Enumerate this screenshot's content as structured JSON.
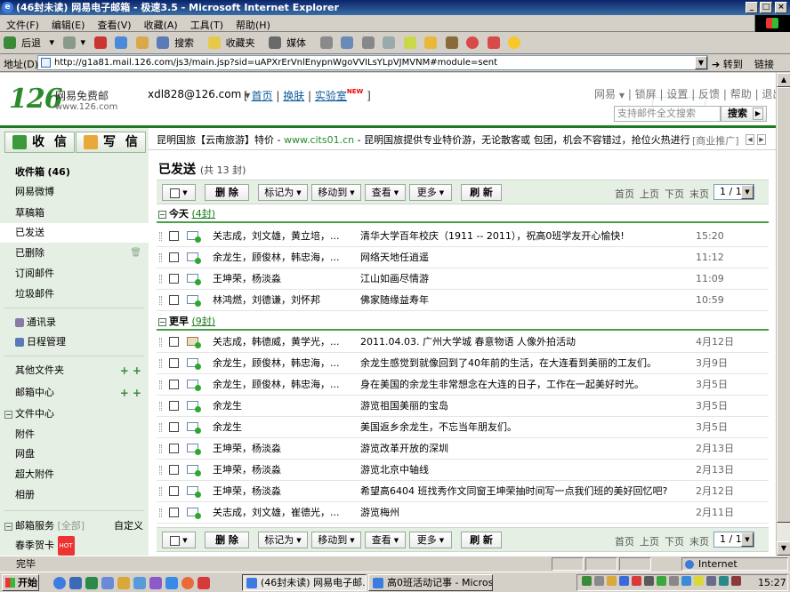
{
  "window": {
    "title": "(46封未读) 网易电子邮箱 - 极速3.5 - Microsoft Internet Explorer"
  },
  "menubar": [
    "文件(F)",
    "编辑(E)",
    "查看(V)",
    "收藏(A)",
    "工具(T)",
    "帮助(H)"
  ],
  "toolbar": {
    "back": "后退",
    "search": "搜索",
    "favorites": "收藏夹",
    "media": "媒体"
  },
  "address": {
    "label": "地址(D)",
    "url": "http://g1a81.mail.126.com/js3/main.jsp?sid=uAPXrErVnlEnypnWgoVVILsYLpVJMVNM#module=sent",
    "go": "转到",
    "links": "链接"
  },
  "header": {
    "logo": "126",
    "brand": "网易免费邮",
    "brand_url": "www.126.com",
    "account": "xdl828@126.com",
    "top_links": [
      "首页",
      "换肤",
      "实验室"
    ],
    "new_badge": "NEW",
    "right_links": [
      "网易",
      "锁屏",
      "设置",
      "反馈",
      "帮助",
      "退出"
    ],
    "search_placeholder": "支持邮件全文搜索",
    "search_button": "搜索"
  },
  "compose": {
    "receive": "收 信",
    "write": "写 信"
  },
  "nav": {
    "inbox": "收件箱",
    "inbox_count": "(46)",
    "weibo": "网易微博",
    "drafts": "草稿箱",
    "sent": "已发送",
    "deleted": "已删除",
    "subscription": "订阅邮件",
    "spam": "垃圾邮件",
    "contacts": "通讯录",
    "calendar": "日程管理",
    "other_folders": "其他文件夹",
    "mail_center": "邮箱中心",
    "file_center": "文件中心",
    "attachments": "附件",
    "netdisk": "网盘",
    "large_attach": "超大附件",
    "album": "相册",
    "services": "邮箱服务",
    "services_all": "[全部]",
    "customize": "自定义",
    "spring_card": "春季贺卡",
    "hot": "HOT"
  },
  "ad": {
    "text_pre": "昆明国旅【云南旅游】特价 - ",
    "url": "www.cits01.cn",
    "text_post": " - 昆明国旅提供专业特价游，无论散客或 包团，机会不容错过，抢位火热进行",
    "tag": "[商业推广]"
  },
  "folder": {
    "title": "已发送",
    "count": "(共 13 封)"
  },
  "actions": {
    "delete": "删 除",
    "mark": "标记为",
    "move": "移动到",
    "view": "查看",
    "more": "更多",
    "refresh": "刷 新",
    "first": "首页",
    "prev": "上页",
    "next": "下页",
    "last": "末页",
    "page": "1 / 1"
  },
  "groups": [
    {
      "label": "今天",
      "count": "(4封)",
      "rows": [
        {
          "from": "关志成，刘文雄，黄立培，...",
          "subject": "清华大学百年校庆（1911 -- 2011），祝高0班学友开心愉快!",
          "date": "15:20"
        },
        {
          "from": "余龙生，顾俊林，韩忠海，...",
          "subject": "网络天地任逍遥",
          "date": "11:12"
        },
        {
          "from": "王坤荣，杨淡淼",
          "subject": "江山如画尽情游",
          "date": "11:09"
        },
        {
          "from": "林鸿燃，刘德谦，刘怀邦",
          "subject": "佛家随缘益寿年",
          "date": "10:59"
        }
      ]
    },
    {
      "label": "更早",
      "count": "(9封)",
      "rows": [
        {
          "from": "关志成，韩德威，黄学光，...",
          "subject": "2011.04.03. 广州大学城 春意物语 人像外拍活动",
          "date": "4月12日"
        },
        {
          "from": "余龙生，顾俊林，韩忠海，...",
          "subject": "余龙生感觉到就像回到了40年前的生活，在大连看到美丽的工友们。",
          "date": "3月9日"
        },
        {
          "from": "余龙生，顾俊林，韩忠海，...",
          "subject": "身在美国的余龙生非常想念在大连的日子，工作在一起美好时光。",
          "date": "3月5日"
        },
        {
          "from": "余龙生",
          "subject": "游览祖国美丽的宝岛",
          "date": "3月5日"
        },
        {
          "from": "余龙生",
          "subject": "美国返乡余龙生，不忘当年朋友们。",
          "date": "3月5日"
        },
        {
          "from": "王坤荣，杨淡淼",
          "subject": "游览改革开放的深圳",
          "date": "2月13日"
        },
        {
          "from": "王坤荣，杨淡淼",
          "subject": "游览北京中轴线",
          "date": "2月13日"
        },
        {
          "from": "王坤荣，杨淡淼",
          "subject": "希望高6404 班找秀作文同窗王坤荣抽时间写一点我们班的美好回忆吧?",
          "date": "2月12日"
        },
        {
          "from": "关志成，刘文雄，崔德光，...",
          "subject": "游览梅州",
          "date": "2月11日"
        }
      ]
    }
  ],
  "status": {
    "text": "完毕",
    "zone": "Internet"
  },
  "taskbar": {
    "start": "开始",
    "tasks": [
      "(46封未读) 网易电子邮...",
      "高0班活动记事 - Microso..."
    ],
    "clock": "15:27"
  }
}
